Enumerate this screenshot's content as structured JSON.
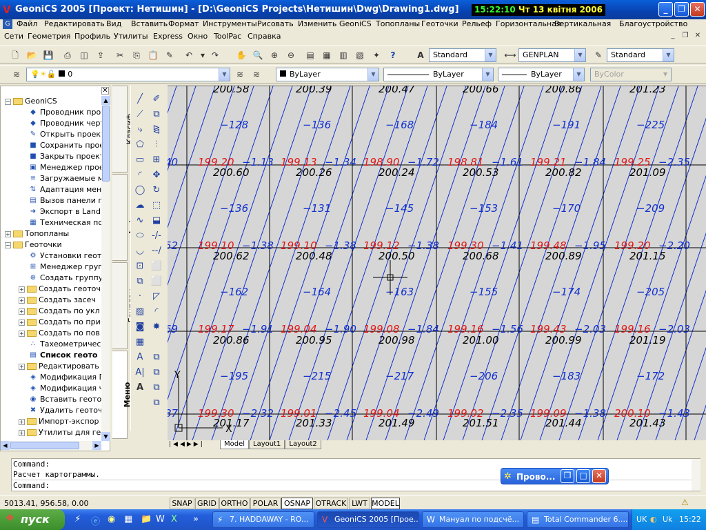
{
  "window": {
    "title": "GeoniCS 2005 [Проект: Нетишин] - [D:\\GeoniCS Projects\\Нетишин\\Dwg\\Drawing1.dwg]",
    "clock_time": "15:22:10",
    "clock_date": "Чт 13 квітня 2006"
  },
  "menubar": [
    "Файл",
    "Редактировать",
    "Вид",
    "Вставить",
    "Формат",
    "Инструменты",
    "Рисовать",
    "Изменить",
    "GeoniCS",
    "Топопланы",
    "Геоточки",
    "Рельеф",
    "Горизонтальная",
    "Вертикальная",
    "Благоустройство"
  ],
  "menubar2": [
    "Сети",
    "Геометрия",
    "Профиль",
    "Утилиты",
    "Express",
    "Окно",
    "ToolPac",
    "Справка"
  ],
  "toolbar": {
    "text_style": "Standard",
    "dim_style": "GENPLAN",
    "table_style": "Standard",
    "layer": "0",
    "color": "ByLayer",
    "linetype": "ByLayer",
    "lineweight": "ByLayer",
    "plotstyle": "ByColor"
  },
  "tree": [
    {
      "level": 0,
      "exp": "−",
      "folder": true,
      "label": "GeoniCS"
    },
    {
      "level": 1,
      "icon": "◆",
      "label": "Проводник про"
    },
    {
      "level": 1,
      "icon": "◆",
      "label": "Проводник черт"
    },
    {
      "level": 1,
      "icon": "✎",
      "label": "Открыть проект"
    },
    {
      "level": 1,
      "icon": "■",
      "label": "Сохранить прое"
    },
    {
      "level": 1,
      "icon": "■",
      "label": "Закрыть проект"
    },
    {
      "level": 1,
      "icon": "▣",
      "label": "Менеджер прое"
    },
    {
      "level": 1,
      "icon": "≡",
      "label": "Загружаемые м"
    },
    {
      "level": 1,
      "icon": "⇅",
      "label": "Адаптация мен"
    },
    {
      "level": 1,
      "icon": "▤",
      "label": "Вызов панели г"
    },
    {
      "level": 1,
      "icon": "➜",
      "label": "Экспорт в Land"
    },
    {
      "level": 1,
      "icon": "▦",
      "label": "Техническая по"
    },
    {
      "level": 0,
      "exp": "+",
      "folder": true,
      "label": "Топопланы"
    },
    {
      "level": 0,
      "exp": "−",
      "folder": true,
      "label": "Геоточки"
    },
    {
      "level": 1,
      "icon": "⚙",
      "label": "Установки геот"
    },
    {
      "level": 1,
      "icon": "⊞",
      "label": "Менеджер груп"
    },
    {
      "level": 1,
      "icon": "⊕",
      "label": "Создать группу"
    },
    {
      "level": 1,
      "exp": "+",
      "folder": true,
      "label": "Создать геоточ"
    },
    {
      "level": 1,
      "exp": "+",
      "folder": true,
      "label": "Создать засеч"
    },
    {
      "level": 1,
      "exp": "+",
      "folder": true,
      "label": "Создать по укл"
    },
    {
      "level": 1,
      "exp": "+",
      "folder": true,
      "label": "Создать по при"
    },
    {
      "level": 1,
      "exp": "+",
      "folder": true,
      "label": "Создать по пов"
    },
    {
      "level": 1,
      "icon": "∴",
      "label": "Тахеометричес"
    },
    {
      "level": 1,
      "icon": "▤",
      "label": "Список геото",
      "bold": true
    },
    {
      "level": 1,
      "exp": "+",
      "folder": true,
      "label": "Редактировать"
    },
    {
      "level": 1,
      "icon": "◈",
      "label": "Модификация Г"
    },
    {
      "level": 1,
      "icon": "◈",
      "label": "Модификация ч"
    },
    {
      "level": 1,
      "icon": "◉",
      "label": "Вставить геото"
    },
    {
      "level": 1,
      "icon": "✖",
      "label": "Удалить геоточ"
    },
    {
      "level": 1,
      "exp": "+",
      "folder": true,
      "label": "Импорт-экспор"
    },
    {
      "level": 1,
      "exp": "+",
      "folder": true,
      "label": "Утилиты для ге"
    }
  ],
  "vtabs": [
    "Класиф",
    "Алфавит",
    "Генплан",
    "Меню"
  ],
  "grid": {
    "rows": [
      [
        {
          "top": "200.58",
          "mid": "−128",
          "red": "199.20",
          "diff": "−1.13"
        },
        {
          "top": "200.39",
          "mid": "−136",
          "red": "199.13",
          "diff": "−1.34"
        },
        {
          "top": "200.47",
          "mid": "−168",
          "red": "198.90",
          "diff": "−1.72"
        },
        {
          "top": "200.66",
          "mid": "−184",
          "red": "198.81",
          "diff": "−1.61"
        },
        {
          "top": "200.86",
          "mid": "−191",
          "red": "199.21",
          "diff": "−1.84"
        },
        {
          "top": "201.23",
          "mid": "−225",
          "red": "199.25",
          "diff": "−2.35"
        }
      ],
      [
        {
          "top": "200.60",
          "mid": "−136",
          "red": "199.10",
          "diff": "−1.38"
        },
        {
          "top": "200.26",
          "mid": "−131",
          "red": "199.10",
          "diff": "−1.38"
        },
        {
          "top": "200.24",
          "mid": "−145",
          "red": "199.12",
          "diff": "−1.38"
        },
        {
          "top": "200.53",
          "mid": "−153",
          "red": "199.30",
          "diff": "−1.41"
        },
        {
          "top": "200.82",
          "mid": "−170",
          "red": "199.48",
          "diff": "−1.95"
        },
        {
          "top": "201.09",
          "mid": "−209",
          "red": "199.20",
          "diff": "−2.20"
        }
      ],
      [
        {
          "top": "200.62",
          "mid": "−162",
          "red": "199.17",
          "diff": "−1.91"
        },
        {
          "top": "200.48",
          "mid": "−164",
          "red": "199.04",
          "diff": "−1.90"
        },
        {
          "top": "200.50",
          "mid": "−163",
          "red": "199.08",
          "diff": "−1.84"
        },
        {
          "top": "200.68",
          "mid": "−155",
          "red": "199.16",
          "diff": "−1.56"
        },
        {
          "top": "200.89",
          "mid": "−174",
          "red": "199.43",
          "diff": "−2.03"
        },
        {
          "top": "201.15",
          "mid": "−205",
          "red": "199.16",
          "diff": "−2.03"
        }
      ],
      [
        {
          "top": "200.86",
          "mid": "−195",
          "red": "199.30",
          "diff": "−2.32"
        },
        {
          "top": "200.95",
          "mid": "−215",
          "red": "199.01",
          "diff": "−2.45"
        },
        {
          "top": "200.98",
          "mid": "−217",
          "red": "199.04",
          "diff": "−2.49"
        },
        {
          "top": "201.00",
          "mid": "−206",
          "red": "199.02",
          "diff": "−2.35"
        },
        {
          "top": "200.99",
          "mid": "−183",
          "red": "199.09",
          "diff": "−1.38"
        },
        {
          "top": "201.19",
          "mid": "−172",
          "red": "200.10",
          "diff": "−1.43"
        }
      ],
      [
        {
          "top": "201.17"
        },
        {
          "top": "201.33"
        },
        {
          "top": "201.49"
        },
        {
          "top": "201.51"
        },
        {
          "top": "201.44"
        },
        {
          "top": "201.43"
        }
      ]
    ],
    "left_edge": [
      "40",
      "52",
      "69",
      "87"
    ],
    "ucs_x": "X",
    "ucs_y": "Y"
  },
  "layout_tabs": [
    "Model",
    "Layout1",
    "Layout2"
  ],
  "command": {
    "line1": "Command:",
    "line2": "Расчет картограммы.",
    "prompt": "Command:"
  },
  "float_window": "Прово...",
  "status": {
    "coords": "5013.41, 956.58, 0.00",
    "buttons": [
      {
        "label": "SNAP",
        "on": false
      },
      {
        "label": "GRID",
        "on": false
      },
      {
        "label": "ORTHO",
        "on": false
      },
      {
        "label": "POLAR",
        "on": false
      },
      {
        "label": "OSNAP",
        "on": true
      },
      {
        "label": "OTRACK",
        "on": false
      },
      {
        "label": "LWT",
        "on": false
      },
      {
        "label": "MODEL",
        "on": true
      }
    ]
  },
  "taskbar": {
    "start": "пуск",
    "tasks": [
      {
        "label": "7. HADDAWAY - RO...",
        "active": false
      },
      {
        "label": "GeoniCS 2005 [Прое...",
        "active": true
      },
      {
        "label": "Мануал по подсчё...",
        "active": false
      },
      {
        "label": "Total Commander 6....",
        "active": false
      }
    ],
    "lang": "UK",
    "lang2": "Uk",
    "time": "15:22"
  },
  "colors": {
    "blue": "#1030d0",
    "red": "#e01818",
    "grid": "#000000"
  }
}
